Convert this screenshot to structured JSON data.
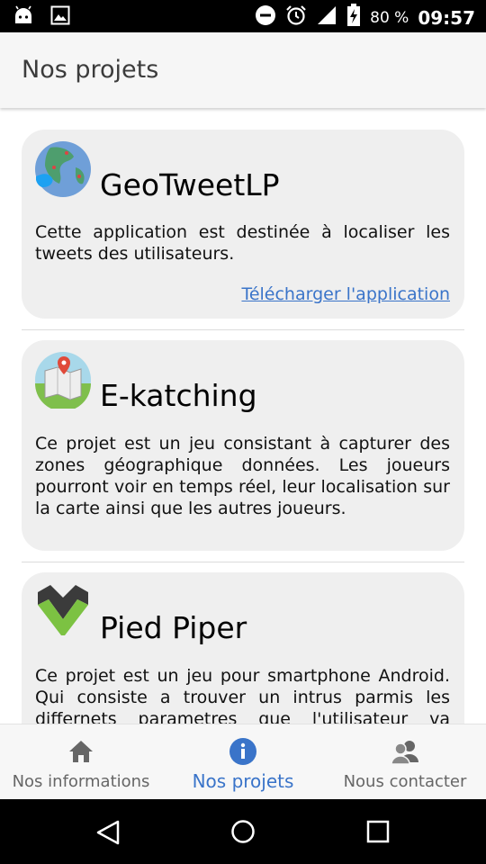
{
  "status_bar": {
    "battery": "80 %",
    "time": "09:57",
    "icons": [
      "android-icon",
      "image-icon",
      "do-not-disturb-icon",
      "alarm-icon",
      "signal-icon",
      "battery-charging-icon"
    ]
  },
  "app_bar": {
    "title": "Nos projets"
  },
  "projects": [
    {
      "title": "GeoTweetLP",
      "description": "Cette application est destinée à localiser les tweets des utilisateurs.",
      "link": "Télécharger l'application",
      "icon": "globe-twitter-icon"
    },
    {
      "title": "E-katching",
      "description": "Ce projet est un jeu consistant à capturer des zones géographique données. Les joueurs pourront voir en temps réel, leur localisation sur la carte ainsi que les autres joueurs.",
      "icon": "map-pin-icon"
    },
    {
      "title": "Pied Piper",
      "description": "Ce projet est un jeu pour smartphone Android. Qui consiste a trouver un intrus parmis les differnets parametres que l'utilisateur va choisir.",
      "icon": "pied-piper-logo-icon"
    }
  ],
  "bottom_nav": {
    "items": [
      {
        "label": "Nos informations",
        "icon": "home-icon"
      },
      {
        "label": "Nos projets",
        "icon": "info-icon"
      },
      {
        "label": "Nous contacter",
        "icon": "contacts-icon"
      }
    ],
    "active_index": 1
  },
  "colors": {
    "accent": "#3a74c9",
    "card_background": "#efefef",
    "status_bar": "#000000"
  }
}
